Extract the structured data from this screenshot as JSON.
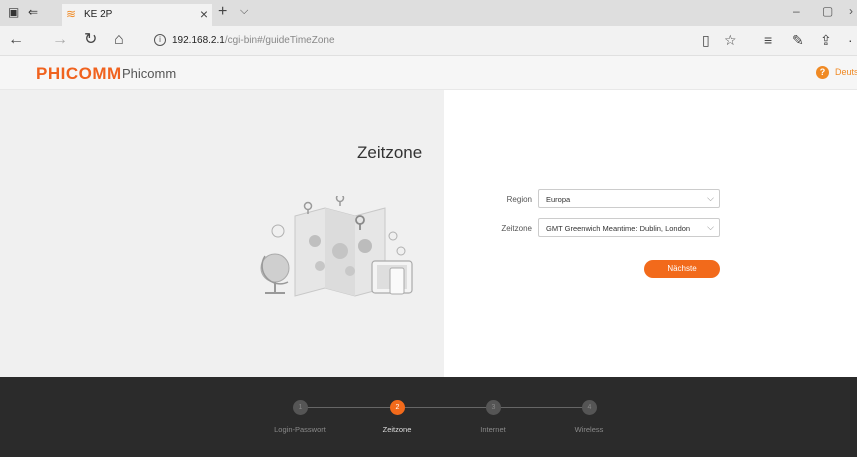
{
  "browser": {
    "tab_title": "KE 2P",
    "url_host": "192.168.2.1",
    "url_path": "/cgi-bin#/guideTimeZone"
  },
  "header": {
    "logo": "PHICOMM",
    "brand": "Phicomm",
    "language": "Deutsc"
  },
  "main": {
    "title": "Zeitzone",
    "region_label": "Region",
    "region_value": "Europa",
    "timezone_label": "Zeitzone",
    "timezone_value": "GMT Greenwich Meantime: Dublin, London",
    "next_button": "Nächste"
  },
  "steps": [
    {
      "number": "1",
      "label": "Login-Passwort",
      "active": false
    },
    {
      "number": "2",
      "label": "Zeitzone",
      "active": true
    },
    {
      "number": "3",
      "label": "Internet",
      "active": false
    },
    {
      "number": "4",
      "label": "Wireless",
      "active": false
    }
  ],
  "colors": {
    "accent": "#f26a1b",
    "footer_bg": "#2b2b2b",
    "left_panel_bg": "#f0f0f0"
  }
}
